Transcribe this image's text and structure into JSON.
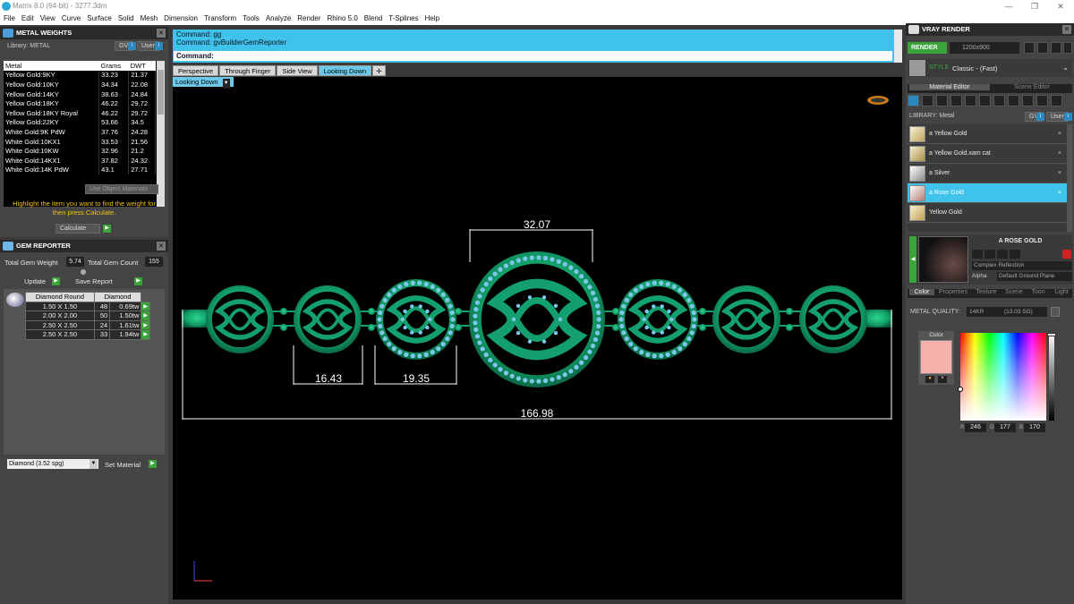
{
  "window": {
    "title": "Matrix 8.0 (64-bit) - 3277.3dm"
  },
  "menu": [
    "File",
    "Edit",
    "View",
    "Curve",
    "Surface",
    "Solid",
    "Mesh",
    "Dimension",
    "Transform",
    "Tools",
    "Analyze",
    "Render",
    "Rhino 5.0",
    "Blend",
    "T-Splines",
    "Help"
  ],
  "metal_weights": {
    "title": "METAL WEIGHTS",
    "library_label": "Library: METAL",
    "gv_label": "GV",
    "user_label": "User",
    "columns": [
      "Metal",
      "Grams",
      "DWT"
    ],
    "rows": [
      [
        "Yellow Gold:9KY",
        "33.23",
        "21.37"
      ],
      [
        "Yellow Gold:10KY",
        "34.34",
        "22.08"
      ],
      [
        "Yellow Gold:14KY",
        "38.63",
        "24.84"
      ],
      [
        "Yellow Gold:18KY",
        "46.22",
        "29.72"
      ],
      [
        "Yellow Gold:18KY Royal",
        "46.22",
        "29.72"
      ],
      [
        "Yellow Gold:22KY",
        "53.66",
        "34.5"
      ],
      [
        "White Gold:9K PdW",
        "37.76",
        "24.28"
      ],
      [
        "White Gold:10KX1",
        "33.53",
        "21.56"
      ],
      [
        "White Gold:10KW",
        "32.96",
        "21.2"
      ],
      [
        "White Gold:14KX1",
        "37.82",
        "24.32"
      ],
      [
        "White Gold:14K PdW",
        "43.1",
        "27.71"
      ]
    ],
    "use_object_materials": "Use Object Materials",
    "hint": "Highlight the item you want to find the weight for then press Calculate.",
    "calculate": "Calculate"
  },
  "gem_reporter": {
    "title": "GEM REPORTER",
    "total_weight_label": "Total Gem Weight",
    "total_weight": "5.74",
    "total_count_label": "Total Gem Count",
    "total_count": "155",
    "update": "Update",
    "save_report": "Save Report",
    "columns": [
      "Diamond Round",
      "Diamond"
    ],
    "rows": [
      [
        "1.50 X 1.50",
        "48",
        "0.69tw"
      ],
      [
        "2.00 X 2.00",
        "50",
        "1.50tw"
      ],
      [
        "2.50 X 2.50",
        "24",
        "1.61tw"
      ],
      [
        "2.50 X 2.50",
        "33",
        "1.94tw"
      ]
    ],
    "material_select": "Diamond    (3.52 spg)",
    "set_material": "Set Material"
  },
  "command": {
    "history": [
      "Command: gg",
      "Command: gvBuilderGemReporter"
    ],
    "prompt": "Command:"
  },
  "viewport": {
    "tabs": [
      "Perspective",
      "Through Finger",
      "Side View",
      "Looking Down"
    ],
    "active_tab": "Looking Down",
    "label": "Looking Down",
    "dimensions": {
      "top": "32.07",
      "left": "16.43",
      "mid": "19.35",
      "total": "166.98"
    }
  },
  "vray": {
    "title": "VRAY RENDER",
    "render_label": "RENDER",
    "resolution": "1200x900",
    "style_label": "STYLE",
    "style_value": "Classic - (Fast)",
    "tabs": [
      "Material Editor",
      "Scene Editor"
    ],
    "library_label": "LIBRARY: Metal",
    "gv_label": "GV",
    "user_label": "User",
    "materials": [
      "a Yellow Gold",
      "a Yellow Gold.xam cat",
      "a Silver",
      "a Rose Gold",
      "Yellow Gold"
    ],
    "selected_material": "a Rose Gold",
    "preview_name": "A ROSE GOLD",
    "reflection": "Complex Reflection",
    "alpha_label": "Alpha",
    "ground": "Default Ground Plane",
    "prop_tabs": [
      "Color",
      "Properties",
      "Texture",
      "Scene",
      "Toon",
      "Light"
    ],
    "metal_quality_label": "METAL QUALITY:",
    "metal_quality": "14KR",
    "metal_quality_sg": "(13.03 SG)",
    "color_label": "Color",
    "swatch_color": "#f6b1aa",
    "r": "246",
    "g": "177",
    "b": "170"
  },
  "colors": {
    "accent": "#3fc3ea",
    "model": "#14a06e",
    "gem": "#7ec7ec"
  }
}
